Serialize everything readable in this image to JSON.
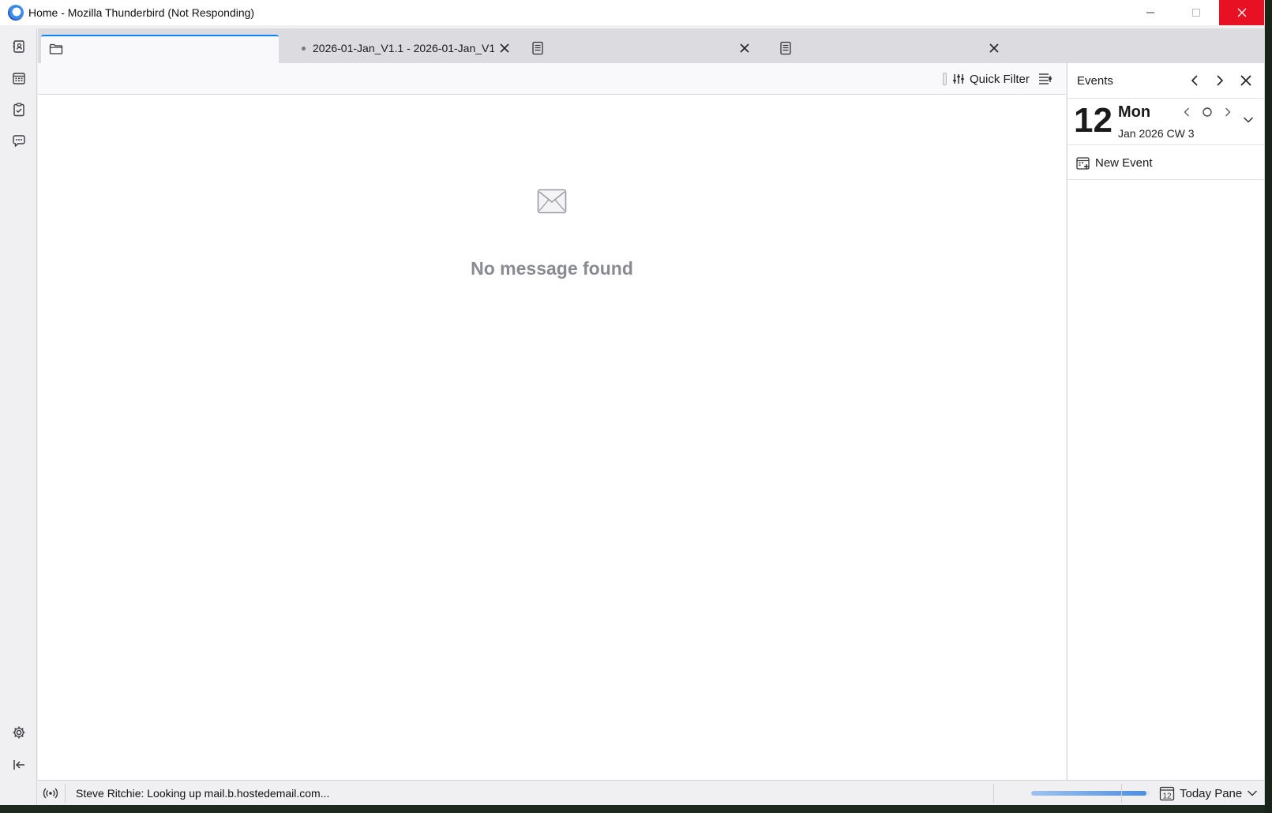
{
  "window": {
    "title": "Home - Mozilla Thunderbird (Not Responding)"
  },
  "spaces": {
    "items": [
      "address-book-icon",
      "calendar-icon",
      "tasks-icon",
      "chat-icon"
    ],
    "bottom": [
      "settings-icon",
      "collapse-icon"
    ]
  },
  "tabs": [
    {
      "label": "",
      "icon": "folder-icon",
      "selected": true
    },
    {
      "label": "2026-01-Jan_V1.1 - 2026-01-Jan_V1",
      "icon": "dot",
      "selected": false
    },
    {
      "label": "",
      "icon": "message-icon",
      "selected": false
    },
    {
      "label": "",
      "icon": "message-icon",
      "selected": false
    }
  ],
  "filterbar": {
    "quick_filter_label": "Quick Filter"
  },
  "message_list": {
    "empty_text": "No message found"
  },
  "today_pane": {
    "title": "Events",
    "day_number": "12",
    "day_name": "Mon",
    "month_year_week": "Jan 2026  CW 3",
    "new_event_label": "New Event"
  },
  "statusbar": {
    "status_text": "Steve Ritchie: Looking up mail.b.hostedemail.com...",
    "progress_fraction": 0.97,
    "today_pane_label": "Today Pane",
    "today_pane_day": "12"
  },
  "colors": {
    "accent": "#0a84ff",
    "close_red": "#e81123",
    "empty_text": "#8a8a93"
  }
}
